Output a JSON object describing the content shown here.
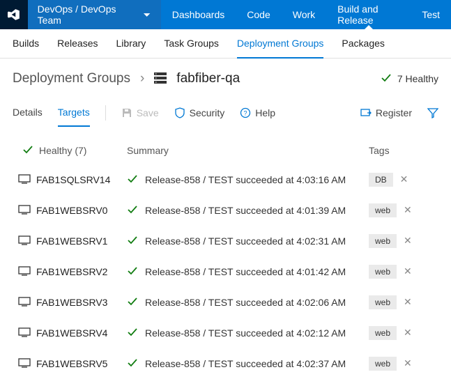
{
  "header": {
    "project": "DevOps / DevOps Team",
    "nav": [
      "Dashboards",
      "Code",
      "Work",
      "Build and Release",
      "Test"
    ],
    "active_nav": 3
  },
  "subnav": {
    "items": [
      "Builds",
      "Releases",
      "Library",
      "Task Groups",
      "Deployment Groups",
      "Packages"
    ],
    "active": 4
  },
  "breadcrumb": {
    "root": "Deployment Groups",
    "current": "fabfiber-qa",
    "health": "7 Healthy"
  },
  "tabs": {
    "items": [
      "Details",
      "Targets"
    ],
    "active": 1,
    "save": "Save",
    "security": "Security",
    "help": "Help",
    "register": "Register"
  },
  "columns": {
    "health": "Healthy (7)",
    "summary": "Summary",
    "tags": "Tags"
  },
  "rows": [
    {
      "name": "FAB1SQLSRV14",
      "summary": "Release-858 / TEST succeeded at 4:03:16 AM",
      "tag": "DB"
    },
    {
      "name": "FAB1WEBSRV0",
      "summary": "Release-858 / TEST succeeded at 4:01:39 AM",
      "tag": "web"
    },
    {
      "name": "FAB1WEBSRV1",
      "summary": "Release-858 / TEST succeeded at 4:02:31 AM",
      "tag": "web"
    },
    {
      "name": "FAB1WEBSRV2",
      "summary": "Release-858 / TEST succeeded at 4:01:42 AM",
      "tag": "web"
    },
    {
      "name": "FAB1WEBSRV3",
      "summary": "Release-858 / TEST succeeded at 4:02:06 AM",
      "tag": "web"
    },
    {
      "name": "FAB1WEBSRV4",
      "summary": "Release-858 / TEST succeeded at 4:02:12 AM",
      "tag": "web"
    },
    {
      "name": "FAB1WEBSRV5",
      "summary": "Release-858 / TEST succeeded at 4:02:37 AM",
      "tag": "web"
    }
  ]
}
